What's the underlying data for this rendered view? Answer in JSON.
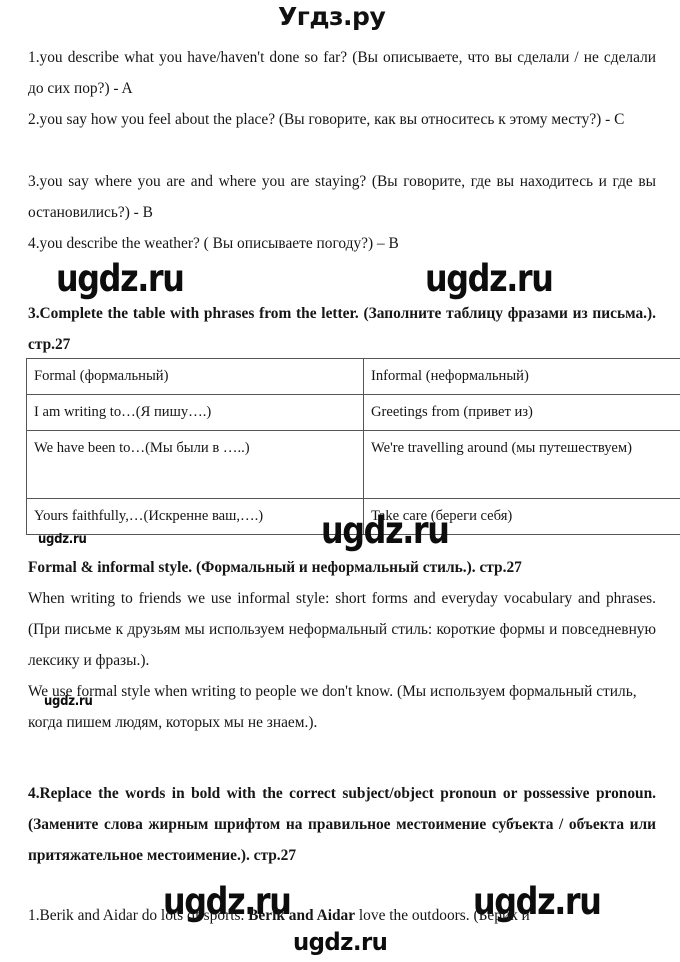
{
  "site": {
    "header_logo": "Угдз.ру",
    "watermark_text": "ugdz.ru"
  },
  "answers_list": {
    "items": [
      "1.you describe what you have/haven't done so far? (Вы описываете, что вы сделали / не сделали до сих пор?) - A",
      "2.you say how you feel about the place? (Вы говорите, как вы относитесь к этому месту?) - C",
      "3.you say where you are and where you are staying? (Вы говорите, где вы находитесь и где вы остановились?) - B",
      "4.you describe the weather? ( Вы описываете погоду?) – B"
    ]
  },
  "task3": {
    "heading": "3.Complete the table with phrases from the letter. (Заполните таблицу фразами из письма.). стр.27",
    "table": {
      "headers": [
        "Formal (формальный)",
        "Informal (неформальный)"
      ],
      "rows": [
        [
          "I am writing to…(Я пишу….)",
          "Greetings from (привет из)"
        ],
        [
          "We have been to…(Мы были в …..)",
          "We're travelling around (мы путешествуем)"
        ],
        [
          "Yours faithfully,…(Искренне ваш,….)",
          "Take care (береги себя)"
        ]
      ]
    }
  },
  "style_section": {
    "heading": "Formal & informal style. (Формальный и неформальный стиль.). стр.27",
    "paragraph1": "When writing to friends we use informal style: short forms and everyday vocabulary and phrases. (При письме к друзьям мы используем неформальный стиль: короткие формы и повседневную лексику и фразы.).",
    "paragraph2": "We use formal style when writing to people we don't know. (Мы используем формальный стиль, когда пишем людям, которых мы не знаем.)."
  },
  "task4": {
    "heading": "4.Replace the words in bold with the correct subject/object pronoun or possessive pronoun. (Замените слова жирным шрифтом на правильное местоимение субъекта / объекта или притяжательное местоимение.). стр.27",
    "item1_part1": "1.Berik and Aidar do lots of sports. ",
    "item1_bold": "Berik and Aidar",
    "item1_part2": " love the outdoors. (Берик и"
  }
}
